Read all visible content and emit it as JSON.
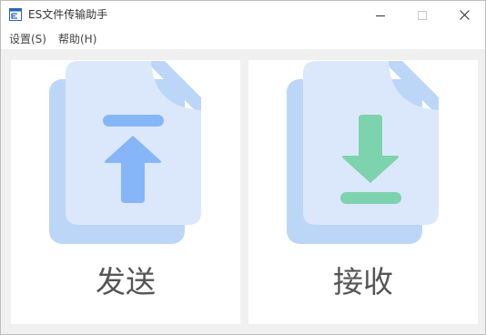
{
  "window": {
    "title": "ES文件传输助手",
    "icon": "es-app-icon",
    "controls": [
      "minimize-icon",
      "maximize-icon",
      "close-icon"
    ]
  },
  "menu": {
    "items": [
      {
        "label": "设置(S)"
      },
      {
        "label": "帮助(H)"
      }
    ]
  },
  "actions": {
    "send": {
      "label": "发送",
      "icon": "upload-file-icon",
      "accent": "#87b6f8",
      "document_color": "#dbe8fb",
      "back_color": "#bcd6f8"
    },
    "receive": {
      "label": "接收",
      "icon": "download-file-icon",
      "accent": "#7dd3ad",
      "document_color": "#dbe8fb",
      "back_color": "#bcd6f8"
    }
  }
}
